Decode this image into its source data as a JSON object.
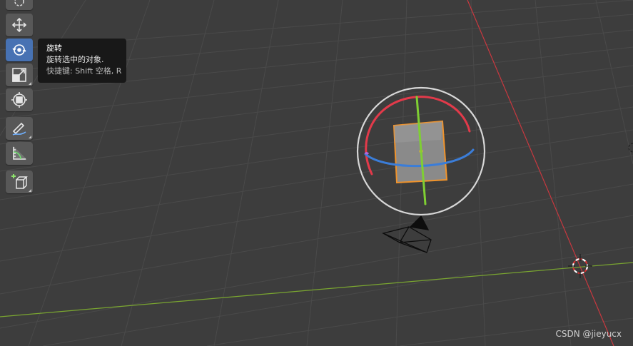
{
  "tooltip": {
    "title": "旋转",
    "description": "旋转选中的对象.",
    "shortcut": "快捷键: Shift 空格, R"
  },
  "toolbar": {
    "tools": [
      {
        "name": "move",
        "icon": "move-icon",
        "active": false
      },
      {
        "name": "rotate",
        "icon": "rotate-icon",
        "active": true
      },
      {
        "name": "scale",
        "icon": "scale-icon",
        "active": false
      },
      {
        "name": "transform",
        "icon": "transform-icon",
        "active": false
      },
      {
        "name": "annotate",
        "icon": "annotate-pencil-icon",
        "active": false
      },
      {
        "name": "measure",
        "icon": "measure-ruler-icon",
        "active": false
      },
      {
        "name": "add-cube",
        "icon": "add-cube-icon",
        "active": false
      }
    ]
  },
  "colors": {
    "background": "#3d3d3d",
    "grid": "#4a4a4a",
    "x_axis": "#c9383f",
    "y_axis": "#7aa630",
    "active_tool": "#4772b3",
    "selection_outline": "#f0932b",
    "gizmo_red": "#e23a4a",
    "gizmo_green": "#7fcf33",
    "gizmo_blue": "#3b7dd8"
  },
  "watermark": "CSDN @jieyucx"
}
